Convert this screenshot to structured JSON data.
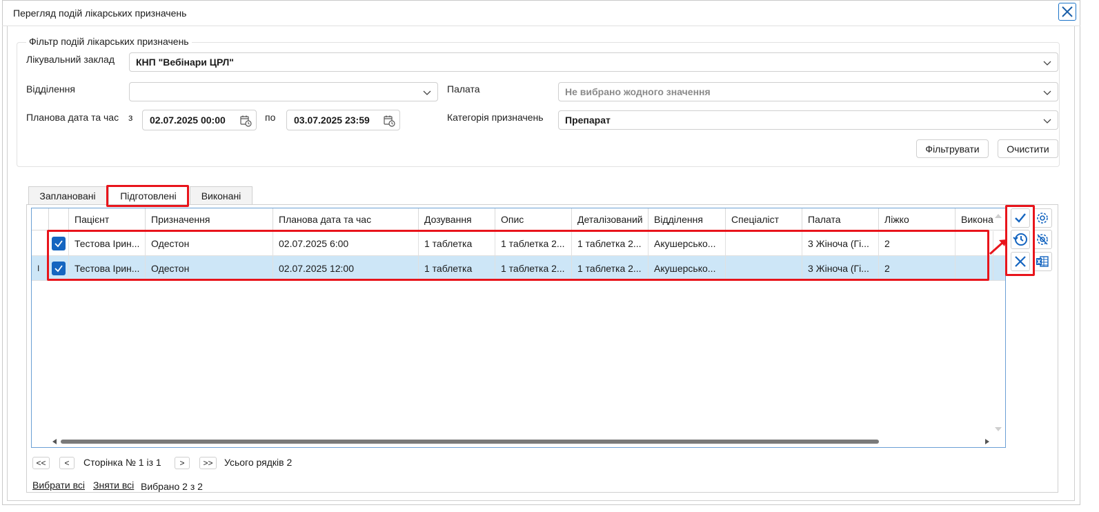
{
  "window": {
    "title": "Перегляд подій лікарських призначень"
  },
  "filter": {
    "legend": "Фільтр подій лікарських призначень",
    "facility_label": "Лікувальний заклад",
    "facility_value": "КНП \"Вебінари ЦРЛ\"",
    "department_label": "Відділення",
    "department_value": "",
    "ward_label": "Палата",
    "ward_placeholder": "Не вибрано жодного значення",
    "date_label": "Планова дата та час",
    "from_label": "з",
    "from_value": "02.07.2025 00:00",
    "to_label": "по",
    "to_value": "03.07.2025 23:59",
    "category_label": "Категорія призначень",
    "category_value": "Препарат",
    "filter_button": "Фільтрувати",
    "clear_button": "Очистити"
  },
  "tabs": [
    {
      "label": "Заплановані",
      "active": false
    },
    {
      "label": "Підготовлені",
      "active": true
    },
    {
      "label": "Виконані",
      "active": false
    }
  ],
  "grid": {
    "columns": [
      "Пацієнт",
      "Призначення",
      "Планова дата та час",
      "Дозування",
      "Опис",
      "Деталізований",
      "Відділення",
      "Спеціаліст",
      "Палата",
      "Ліжко",
      "Викона"
    ],
    "rows": [
      {
        "checked": true,
        "selected": false,
        "cells": [
          "Тестова Ірин...",
          "Одестон",
          "02.07.2025 6:00",
          "1 таблетка",
          "1 таблетка 2...",
          "1 таблетка 2...",
          "Акушерсько...",
          "",
          "3 Жіноча (Гі...",
          "2",
          ""
        ]
      },
      {
        "checked": true,
        "selected": true,
        "cells": [
          "Тестова Ірин...",
          "Одестон",
          "02.07.2025 12:00",
          "1 таблетка",
          "1 таблетка 2...",
          "1 таблетка 2...",
          "Акушерсько...",
          "",
          "3 Жіноча (Гі...",
          "2",
          ""
        ]
      }
    ],
    "cursor_mark": "I"
  },
  "pager": {
    "first": "<<",
    "prev": "<",
    "page_text": "Сторінка № 1 із 1",
    "next": ">",
    "last": ">>",
    "total_text": "Усього рядків 2"
  },
  "selection": {
    "select_all": "Вибрати всі",
    "deselect_all": "Зняти всі",
    "selected_text": "Вибрано 2 з 2"
  },
  "side_actions": [
    "confirm-icon",
    "history-icon",
    "cancel-icon",
    "settings-icon",
    "settings-reset-icon",
    "excel-export-icon"
  ],
  "colors": {
    "accent": "#1565c0",
    "highlight": "#e8141b",
    "selected_row": "#cde6f7"
  }
}
